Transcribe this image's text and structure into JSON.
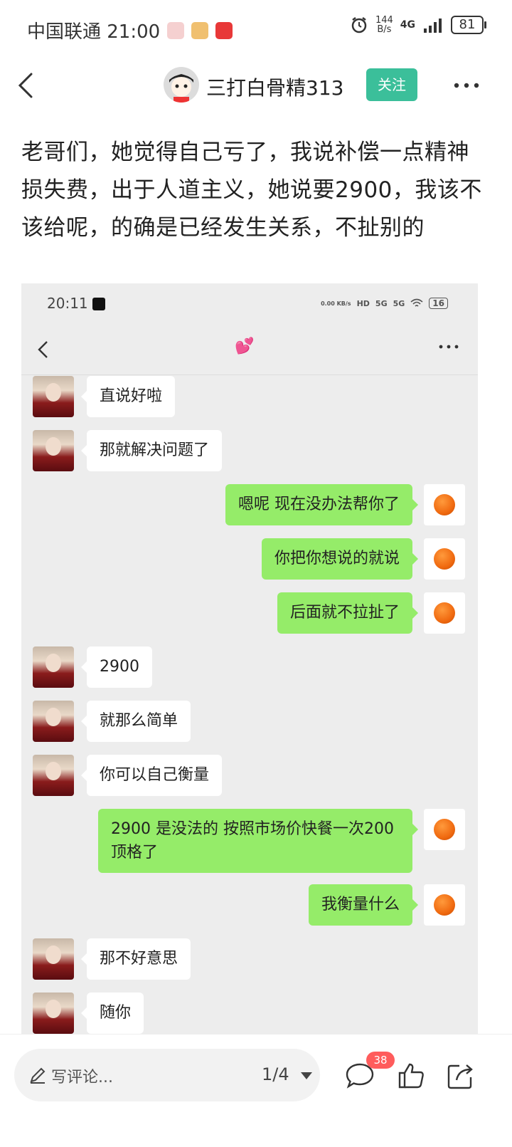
{
  "status_bar": {
    "carrier_time": "中国联通 21:00",
    "speed_value": "144",
    "speed_unit": "B/s",
    "network": "4G",
    "battery": "81"
  },
  "header": {
    "author_name": "三打白骨精313",
    "follow_label": "关注"
  },
  "post": {
    "text": "老哥们，她觉得自己亏了，我说补偿一点精神损失费，出于人道主义，她说要2900，我该不该给呢，的确是已经发生关系，不扯别的"
  },
  "screenshot": {
    "time": "20:11",
    "status_icons": [
      "0.00 KB/s",
      "HD",
      "5G",
      "5G",
      "16"
    ],
    "chat_title": "💕",
    "messages": [
      {
        "side": "left",
        "text": "直说好啦"
      },
      {
        "side": "left",
        "text": "那就解决问题了"
      },
      {
        "side": "right",
        "text": "嗯呢 现在没办法帮你了"
      },
      {
        "side": "right",
        "text": "你把你想说的就说"
      },
      {
        "side": "right",
        "text": "后面就不拉扯了"
      },
      {
        "side": "left",
        "text": "2900"
      },
      {
        "side": "left",
        "text": "就那么简单"
      },
      {
        "side": "left",
        "text": "你可以自己衡量"
      },
      {
        "side": "right",
        "text": "2900 是没法的 按照市场价快餐一次200 顶格了"
      },
      {
        "side": "right",
        "text": "我衡量什么"
      },
      {
        "side": "left",
        "text": "那不好意思"
      },
      {
        "side": "left",
        "text": "随你"
      }
    ]
  },
  "bottom_bar": {
    "comment_placeholder": "写评论...",
    "page_indicator": "1/4",
    "comment_count": "38"
  },
  "colors": {
    "follow_button": "#3bbf9a",
    "sent_bubble": "#95ec69",
    "badge": "#ff5c5c"
  }
}
